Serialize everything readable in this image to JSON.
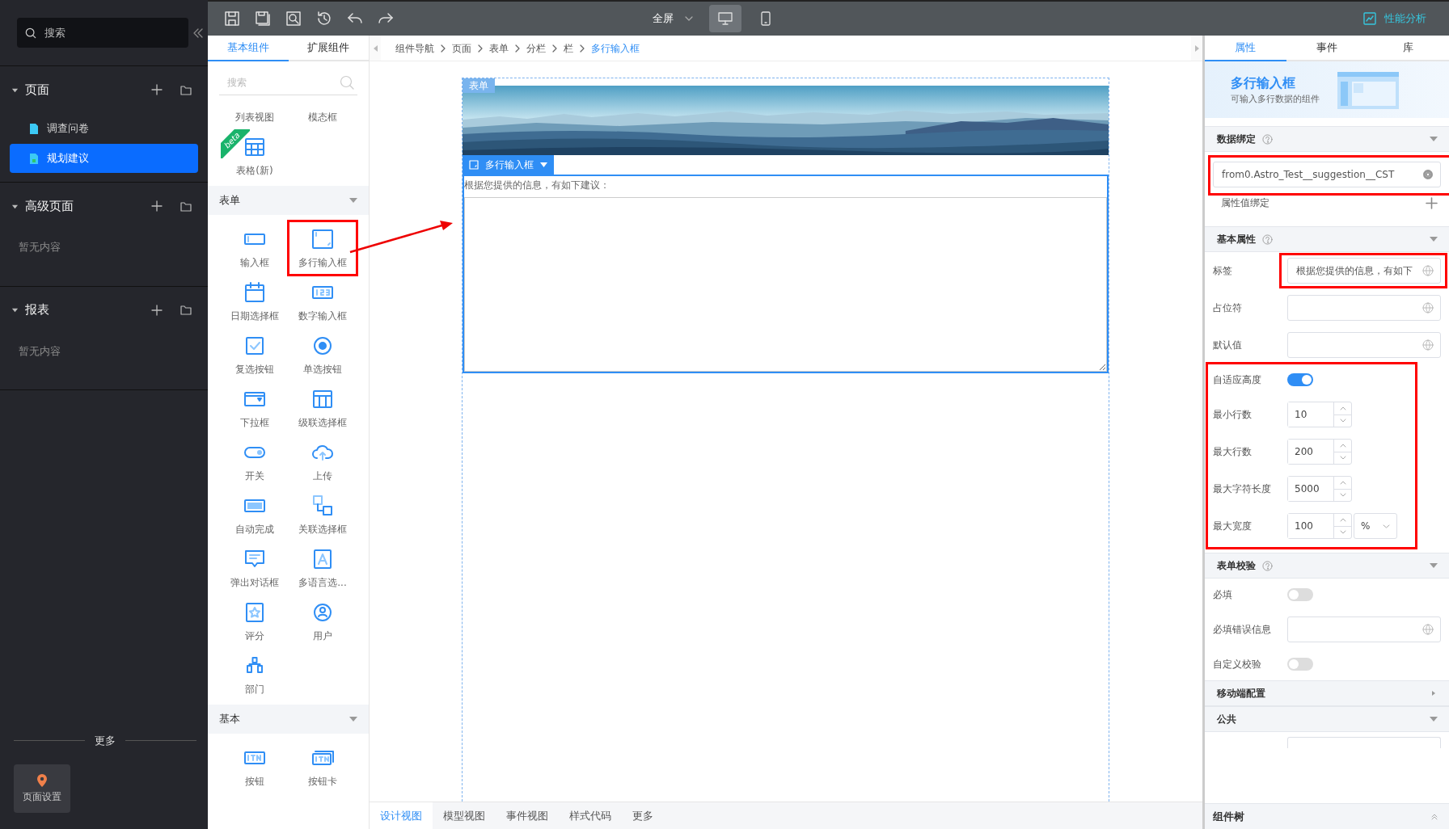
{
  "sidebar": {
    "search": {
      "placeholder": "搜索"
    },
    "groups": [
      {
        "title": "页面",
        "expanded": true,
        "items": [
          {
            "label": "调查问卷",
            "selected": false
          },
          {
            "label": "规划建议",
            "selected": true
          }
        ]
      },
      {
        "title": "高级页面",
        "expanded": true,
        "empty_text": "暂无内容"
      },
      {
        "title": "报表",
        "expanded": true,
        "empty_text": "暂无内容"
      }
    ],
    "more": "更多",
    "settings_button": "页面设置"
  },
  "toolbar": {
    "view_mode": "全屏",
    "devices": [
      {
        "kind": "desktop",
        "selected": true
      },
      {
        "kind": "mobile",
        "selected": false
      }
    ],
    "analysis": "性能分析"
  },
  "component_panel": {
    "tabs": [
      {
        "label": "基本组件",
        "selected": true
      },
      {
        "label": "扩展组件",
        "selected": false
      }
    ],
    "search": {
      "placeholder": "搜索"
    },
    "sections": [
      {
        "items": [
          {
            "label": "列表视图",
            "kind": "text"
          },
          {
            "label": "模态框",
            "kind": "text"
          },
          {
            "label": "表格(新)",
            "kind": "table",
            "badge": "beta"
          }
        ]
      },
      {
        "title": "表单",
        "expanded": true,
        "items": [
          {
            "label": "输入框",
            "kind": "input"
          },
          {
            "label": "多行输入框",
            "kind": "textarea"
          },
          {
            "label": "日期选择框",
            "kind": "date"
          },
          {
            "label": "数字输入框",
            "kind": "number"
          },
          {
            "label": "复选按钮",
            "kind": "checkbox"
          },
          {
            "label": "单选按钮",
            "kind": "radio"
          },
          {
            "label": "下拉框",
            "kind": "select"
          },
          {
            "label": "级联选择框",
            "kind": "cascade"
          },
          {
            "label": "开关",
            "kind": "switch"
          },
          {
            "label": "上传",
            "kind": "upload"
          },
          {
            "label": "自动完成",
            "kind": "autocomplete"
          },
          {
            "label": "关联选择框",
            "kind": "linked"
          },
          {
            "label": "弹出对话框",
            "kind": "dialog"
          },
          {
            "label": "多语言选...",
            "kind": "lang"
          },
          {
            "label": "评分",
            "kind": "rate"
          },
          {
            "label": "用户",
            "kind": "user"
          },
          {
            "label": "部门",
            "kind": "dept"
          }
        ]
      },
      {
        "title": "基本",
        "expanded": true,
        "items": [
          {
            "label": "按钮",
            "kind": "btn"
          },
          {
            "label": "按钮卡",
            "kind": "btncard"
          }
        ]
      }
    ]
  },
  "breadcrumb": [
    {
      "label": "组件导航",
      "selected": false
    },
    {
      "label": "页面",
      "selected": false
    },
    {
      "label": "表单",
      "selected": false
    },
    {
      "label": "分栏",
      "selected": false
    },
    {
      "label": "栏",
      "selected": false
    },
    {
      "label": "多行输入框",
      "selected": true
    }
  ],
  "canvas": {
    "form_tag": "表单",
    "component_tag": "多行输入框",
    "field_label": "根据您提供的信息，有如下建议："
  },
  "bottom_tabs": [
    {
      "label": "设计视图",
      "selected": true
    },
    {
      "label": "模型视图",
      "selected": false
    },
    {
      "label": "事件视图",
      "selected": false
    },
    {
      "label": "样式代码",
      "selected": false
    },
    {
      "label": "更多",
      "selected": false
    }
  ],
  "properties": {
    "tabs": [
      {
        "label": "属性",
        "selected": true
      },
      {
        "label": "事件",
        "selected": false
      },
      {
        "label": "库",
        "selected": false
      }
    ],
    "header": {
      "title": "多行输入框",
      "subtitle": "可输入多行数据的组件"
    },
    "sections": [
      {
        "title": "数据绑定",
        "help": true,
        "expanded": true,
        "rows": [
          {
            "kind": "binding",
            "value": "from0.Astro_Test__suggestion__CST"
          },
          {
            "kind": "add",
            "label": "属性值绑定"
          }
        ]
      },
      {
        "title": "基本属性",
        "help": true,
        "expanded": true,
        "rows": [
          {
            "kind": "text",
            "label": "标签",
            "value": "根据您提供的信息，有如下"
          },
          {
            "kind": "text",
            "label": "占位符"
          },
          {
            "kind": "text",
            "label": "默认值"
          },
          {
            "kind": "toggle",
            "label": "自适应高度",
            "on": true
          },
          {
            "kind": "number",
            "label": "最小行数",
            "value": "10"
          },
          {
            "kind": "number",
            "label": "最大行数",
            "value": "200"
          },
          {
            "kind": "number",
            "label": "最大字符长度",
            "value": "5000"
          },
          {
            "kind": "number",
            "label": "最大宽度",
            "value": "100",
            "unit": "%"
          }
        ]
      },
      {
        "title": "表单校验",
        "help": true,
        "expanded": true,
        "rows": [
          {
            "kind": "toggle",
            "label": "必填",
            "on": false
          },
          {
            "kind": "text",
            "label": "必填错误信息"
          },
          {
            "kind": "toggle",
            "label": "自定义校验",
            "on": false
          }
        ]
      },
      {
        "title": "移动端配置",
        "help": false,
        "expanded": false
      },
      {
        "title": "公共",
        "help": false,
        "expanded": true,
        "rows": [
          {
            "kind": "stub"
          }
        ]
      }
    ]
  },
  "component_tree": "组件树"
}
